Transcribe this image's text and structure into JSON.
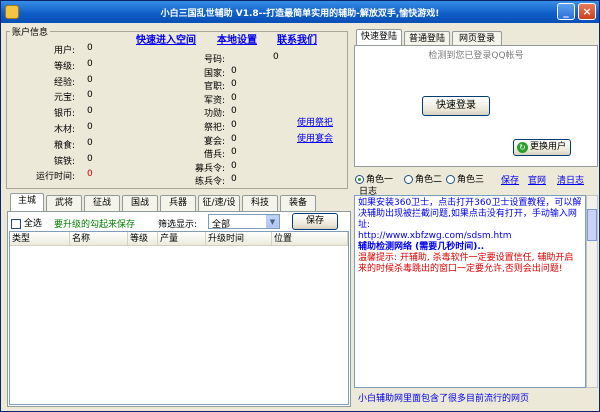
{
  "window": {
    "title": "小白三国乱世辅助 V1.8--打造最简单实用的辅助-解放双手,愉快游戏!"
  },
  "account": {
    "group_title": "账户信息",
    "fields_left": [
      {
        "label": "用户:",
        "value": "0"
      },
      {
        "label": "等级:",
        "value": "0"
      },
      {
        "label": "经验:",
        "value": "0"
      },
      {
        "label": "元宝:",
        "value": "0"
      },
      {
        "label": "银币:",
        "value": "0"
      },
      {
        "label": "木材:",
        "value": "0"
      },
      {
        "label": "粮食:",
        "value": "0"
      },
      {
        "label": "镔铁:",
        "value": "0"
      },
      {
        "label": "运行时间:",
        "value": "0"
      }
    ],
    "fields_right": [
      {
        "label": "号码:",
        "value": "0"
      },
      {
        "label": "国家:",
        "value": "0"
      },
      {
        "label": "官职:",
        "value": "0"
      },
      {
        "label": "军资:",
        "value": "0"
      },
      {
        "label": "功勋:",
        "value": "0"
      },
      {
        "label": "祭祀:",
        "value": "0"
      },
      {
        "label": "宴会:",
        "value": "0"
      },
      {
        "label": "借兵:",
        "value": "0"
      },
      {
        "label": "募兵令:",
        "value": "0"
      },
      {
        "label": "练兵令:",
        "value": "0"
      }
    ],
    "links": {
      "quick_enter": "快速进入空间",
      "local_settings": "本地设置",
      "contact_us": "联系我们",
      "use_sacrifice": "使用祭祀",
      "use_banquet": "使用宴会"
    }
  },
  "main_tabs": [
    "主城",
    "武将",
    "征战",
    "国战",
    "兵器",
    "征/速/设",
    "科技",
    "装备"
  ],
  "main_toolbar": {
    "select_all": "全选",
    "hint": "要升级的勾起来保存",
    "filter_label": "筛选显示:",
    "filter_value": "全部",
    "save": "保存"
  },
  "table_columns": [
    "类型",
    "名称",
    "等级",
    "产量",
    "升级时间",
    "位置"
  ],
  "login": {
    "tabs": [
      "快速登陆",
      "普通登陆",
      "网页登录"
    ],
    "hint": "检测到您已登录QQ帐号",
    "quick_login": "快速登录",
    "change_user": "更换用户"
  },
  "roles": [
    "角色一",
    "角色二",
    "角色三"
  ],
  "role_links": {
    "save": "保存",
    "website": "官网",
    "clear_log": "清日志"
  },
  "log": {
    "title": "日志",
    "lines": [
      "如果安装360卫士，点击打开360卫士设置教程，可以解决辅助出现被拦截问题,如果点击没有打开，手动输入网址:",
      "http://www.xbfzwg.com/sdsm.htm",
      "辅助检测网络 (需要几秒时间)..",
      "温馨提示: 开辅助, 杀毒软件一定要设置信任, 辅助开启来的时候杀毒跳出的窗口一定要允许,否则会出问题!"
    ]
  },
  "status_text": "小白辅助网里面包含了很多目前流行的网页"
}
